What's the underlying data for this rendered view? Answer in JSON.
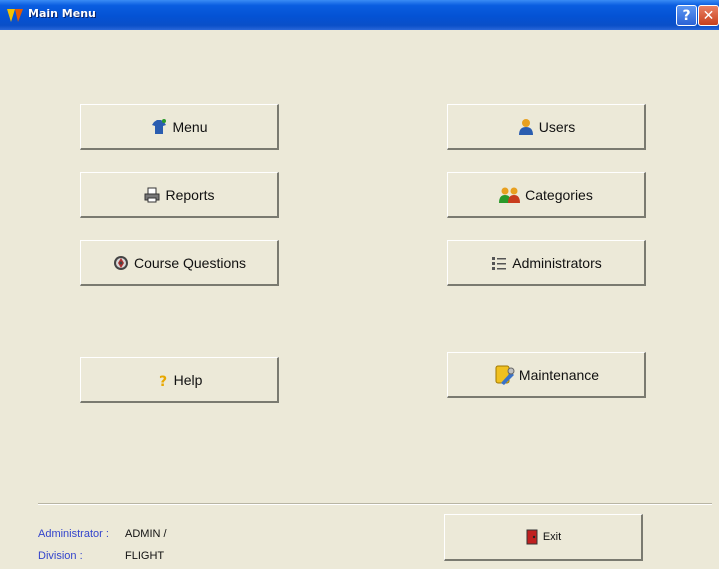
{
  "window": {
    "title": "Main Menu",
    "help_glyph": "?",
    "close_glyph": "✕"
  },
  "buttons": {
    "menu": {
      "label": "Menu",
      "icon": "shirt-icon"
    },
    "users": {
      "label": "Users",
      "icon": "user-icon"
    },
    "reports": {
      "label": "Reports",
      "icon": "printer-icon"
    },
    "categories": {
      "label": "Categories",
      "icon": "group-icon"
    },
    "course_questions": {
      "label": "Course Questions",
      "icon": "disc-icon"
    },
    "administrators": {
      "label": "Administrators",
      "icon": "list-icon"
    },
    "help": {
      "label": "Help",
      "icon": "question-icon"
    },
    "maintenance": {
      "label": "Maintenance",
      "icon": "tools-icon"
    },
    "exit": {
      "label": "Exit",
      "icon": "door-icon"
    }
  },
  "status": {
    "administrator_label": "Administrator :",
    "administrator_value": "ADMIN /",
    "division_label": "Division :",
    "division_value": "FLIGHT"
  },
  "colors": {
    "accent": "#3344cc",
    "titlebar": "#0452d4",
    "background": "#ece9d8"
  }
}
